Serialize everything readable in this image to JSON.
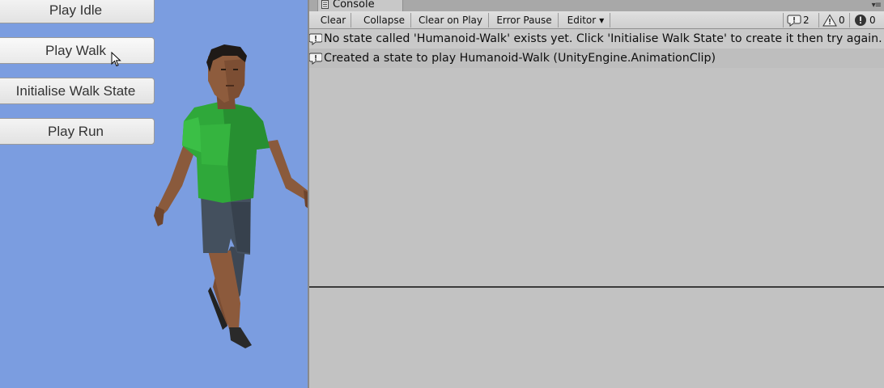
{
  "game": {
    "buttons": {
      "play_idle": "Play Idle",
      "play_walk": "Play Walk",
      "init_walk": "Initialise Walk State",
      "play_run": "Play Run"
    }
  },
  "console": {
    "tab_title": "Console",
    "toolbar": {
      "clear": "Clear",
      "collapse": "Collapse",
      "clear_on_play": "Clear on Play",
      "error_pause": "Error Pause",
      "editor": "Editor"
    },
    "counts": {
      "log": "2",
      "warning": "0",
      "error": "0"
    },
    "entries": [
      {
        "icon": "info-icon",
        "text": "No state called 'Humanoid-Walk' exists yet. Click 'Initialise Walk State' to create it then try again."
      },
      {
        "icon": "info-icon",
        "text": "Created a state to play Humanoid-Walk (UnityEngine.AnimationClip)"
      }
    ]
  },
  "colors": {
    "game_background": "#7b9de0",
    "console_background": "#c2c2c2",
    "shirt": "#2fa83a",
    "shorts": "#3f4a57",
    "skin": "#8a5a3c"
  }
}
